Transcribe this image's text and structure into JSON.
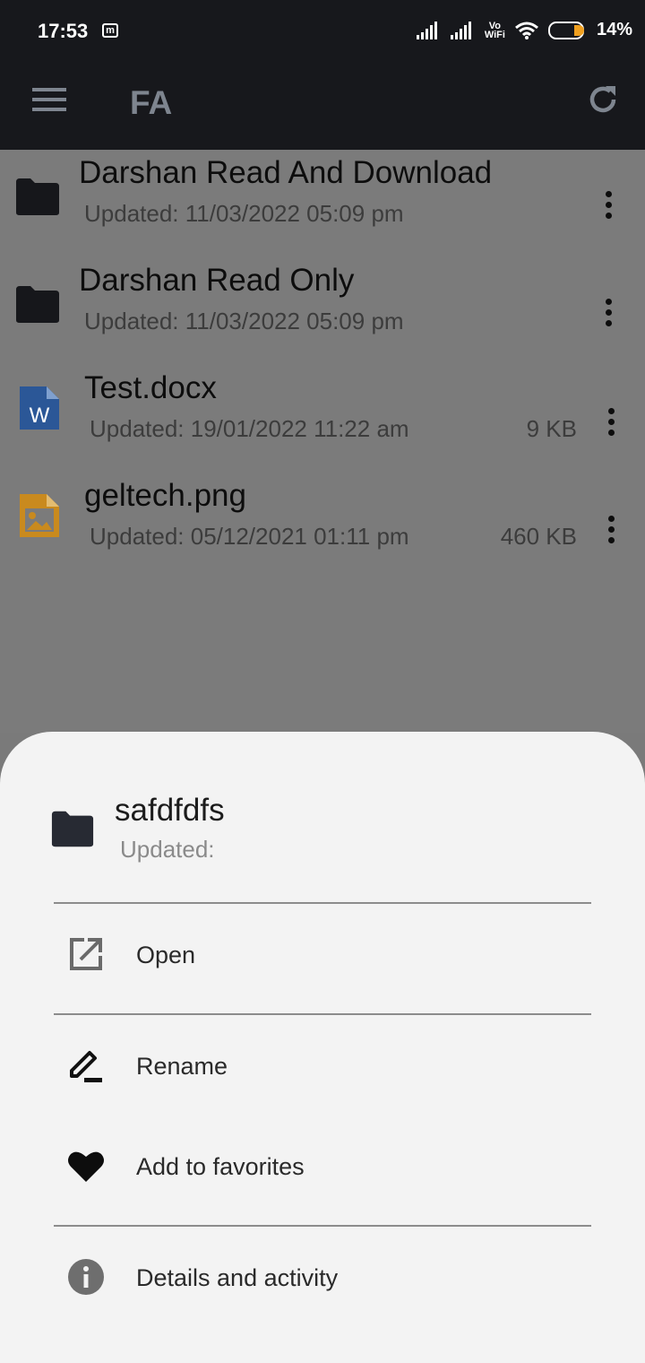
{
  "status_bar": {
    "time": "17:53",
    "notif_icon": "m",
    "vowifi_top": "Vo",
    "vowifi_bottom": "WiFi",
    "battery": "14%"
  },
  "app_bar": {
    "title": "FA"
  },
  "files": [
    {
      "name": "Darshan Read And Download",
      "updated": "Updated: 11/03/2022 05:09 pm",
      "size": "",
      "icon": "folder-icon"
    },
    {
      "name": "Darshan Read Only",
      "updated": "Updated: 11/03/2022 05:09 pm",
      "size": "",
      "icon": "folder-icon"
    },
    {
      "name": "Test.docx",
      "updated": "Updated: 19/01/2022 11:22 am",
      "size": "9 KB",
      "icon": "word-doc-icon"
    },
    {
      "name": "geltech.png",
      "updated": "Updated: 05/12/2021 01:11 pm",
      "size": "460 KB",
      "icon": "image-file-icon"
    }
  ],
  "sheet": {
    "item_name": "safdfdfs",
    "item_meta": "Updated:",
    "actions": [
      {
        "label": "Open",
        "icon": "open-external-icon"
      },
      {
        "label": "Rename",
        "icon": "rename-pencil-icon"
      },
      {
        "label": "Add to favorites",
        "icon": "heart-icon"
      },
      {
        "label": "Details and activity",
        "icon": "info-icon"
      }
    ]
  },
  "colors": {
    "bar_bg": "#17181c",
    "scrim": "#7b7b7b",
    "sheet_bg": "#f3f3f3",
    "word_blue": "#2b5797",
    "image_orange": "#c98a1e"
  }
}
